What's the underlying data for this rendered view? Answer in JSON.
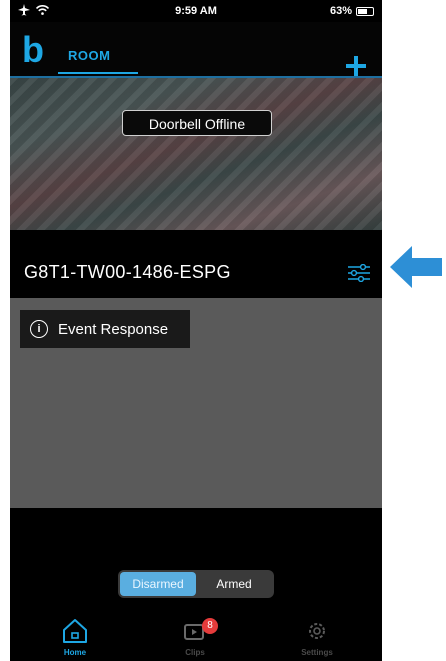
{
  "status_bar": {
    "time": "9:59 AM",
    "battery": "63%",
    "battery_level": 0.63
  },
  "header": {
    "logo": "b",
    "tab_label": "ROOM",
    "add_icon": "plus-icon"
  },
  "camera": {
    "status_label": "Doorbell Offline"
  },
  "device": {
    "name": "G8T1-TW00-1486-ESPG",
    "settings_icon": "sliders-icon"
  },
  "event": {
    "label": "Event Response",
    "icon": "info-icon"
  },
  "mode_toggle": {
    "options": [
      "Disarmed",
      "Armed"
    ],
    "selected": "Disarmed"
  },
  "tab_bar": {
    "items": [
      {
        "label": "Home",
        "icon": "home-icon",
        "active": true
      },
      {
        "label": "Clips",
        "icon": "clips-icon",
        "badge": "8"
      },
      {
        "label": "Settings",
        "icon": "gear-icon"
      }
    ]
  },
  "colors": {
    "accent": "#1ea7e4",
    "toggle_active": "#5aaee0",
    "badge": "#e53b3b",
    "event_area": "#5a5a5a"
  }
}
